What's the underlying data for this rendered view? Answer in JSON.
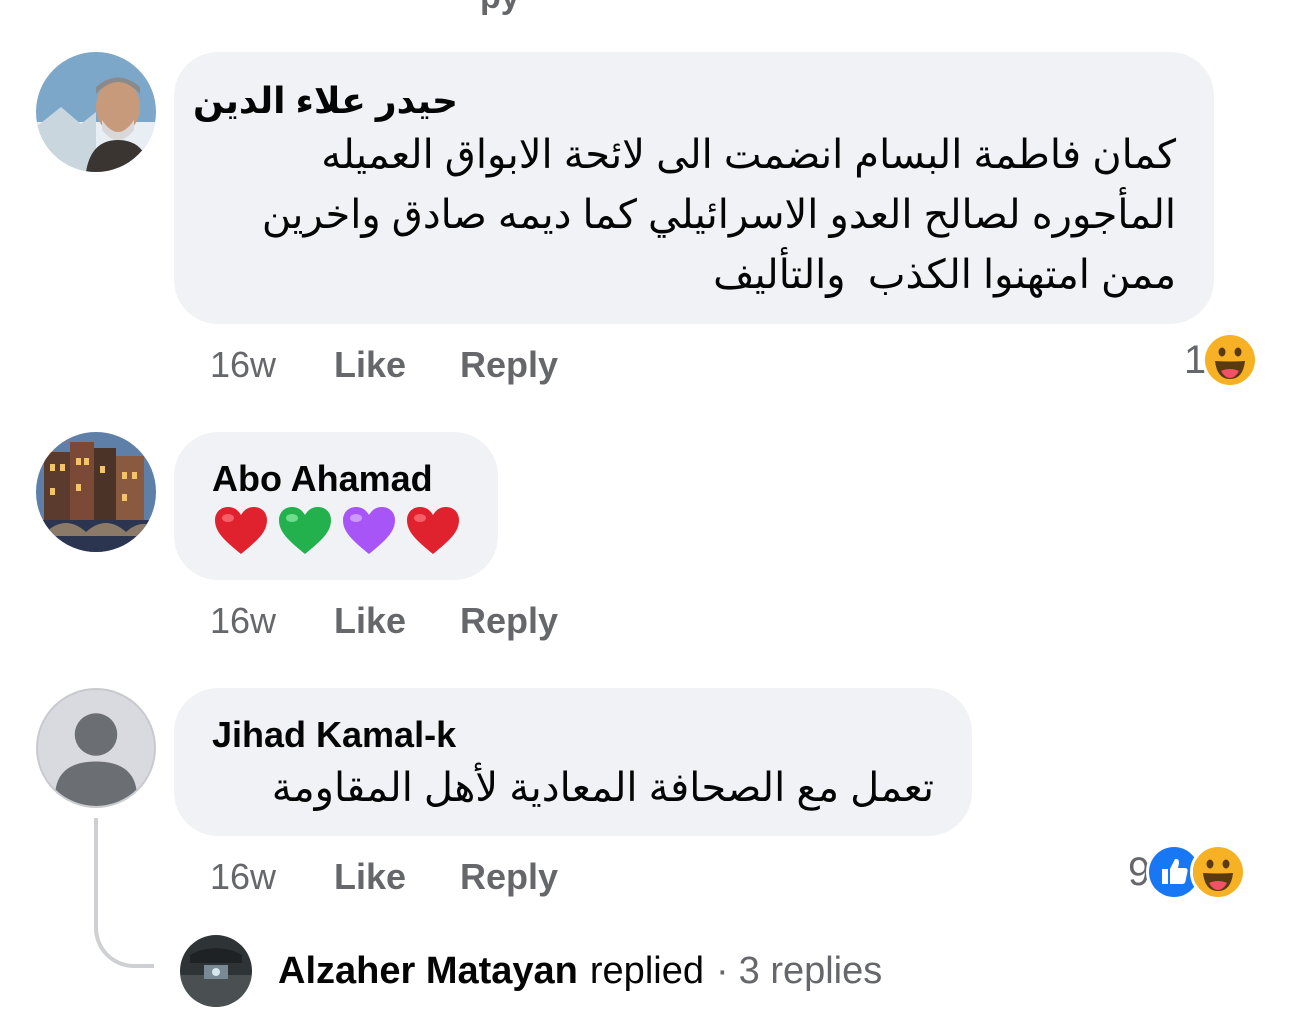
{
  "comments": [
    {
      "author": "حيدر علاء الدين",
      "text": "كمان فاطمة البسام انضمت الى لائحة الابواق العميله\nالمأجوره لصالح العدو الاسرائيلي كما ديمه صادق واخرين\nممن امتهنوا الكذب  والتأليف",
      "time": "16w",
      "like": "Like",
      "reply": "Reply",
      "reaction_count": "1",
      "reaction_icons": [
        "haha-icon"
      ]
    },
    {
      "author": "Abo Ahamad",
      "text": "",
      "hearts": [
        "red-heart",
        "green-heart",
        "purple-heart",
        "red-heart"
      ],
      "time": "16w",
      "like": "Like",
      "reply": "Reply"
    },
    {
      "author": "Jihad Kamal-k",
      "text": "تعمل مع الصحافة المعادية لأهل المقاومة",
      "time": "16w",
      "like": "Like",
      "reply": "Reply",
      "reaction_count": "9",
      "reaction_icons": [
        "like-icon",
        "haha-icon"
      ]
    }
  ],
  "reply_thread": {
    "name": "Alzaher Matayan",
    "verb": "replied",
    "dot": "·",
    "count": "3 replies"
  },
  "colors": {
    "bubble": "#f0f2f5",
    "muted": "#65676b",
    "like_blue": "#1877f2",
    "haha_yellow": "#f7b125",
    "heart_red": "#e0212e",
    "heart_green": "#22b14c",
    "heart_purple": "#a855f7"
  }
}
